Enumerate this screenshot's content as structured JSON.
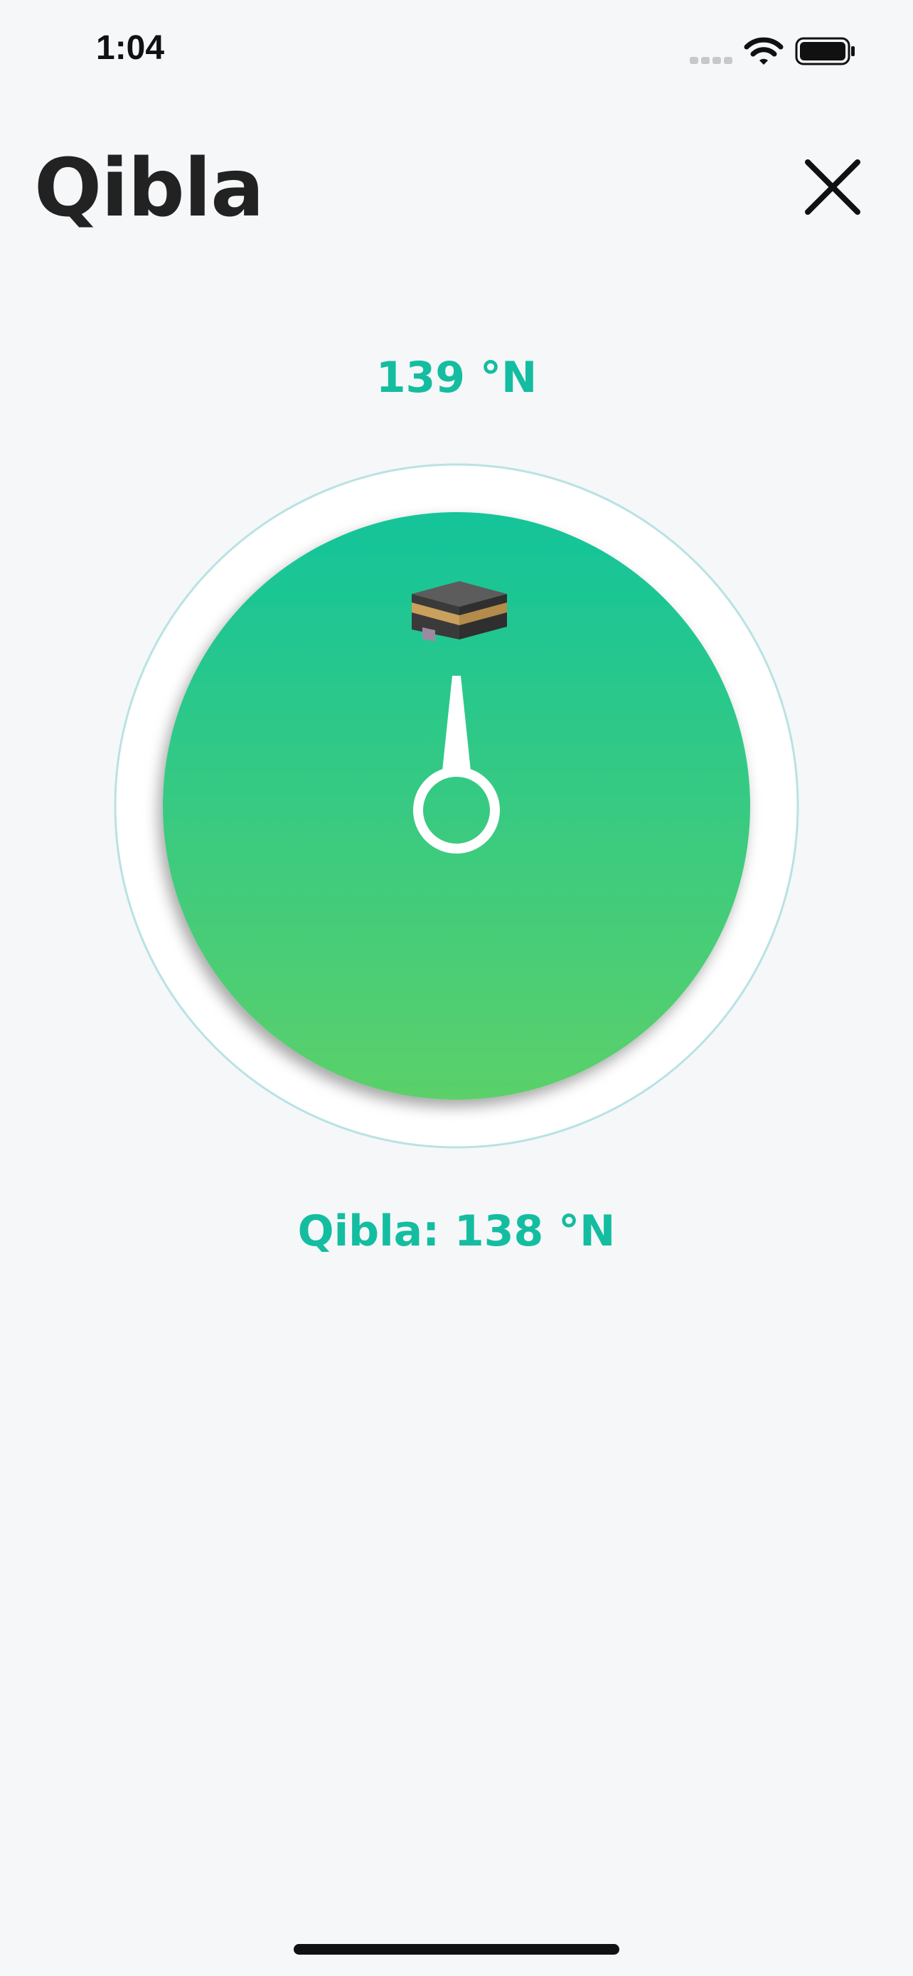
{
  "status_bar": {
    "time": "1:04",
    "icons": [
      "signal-icon",
      "wifi-icon",
      "battery-icon"
    ]
  },
  "header": {
    "title": "Qibla",
    "close_icon": "close-icon"
  },
  "compass": {
    "heading": "139 °N",
    "qibla": "Qibla: 138 °N",
    "kaaba_icon": "kaaba-icon",
    "colors": {
      "dial_top": "#14c49a",
      "dial_bottom": "#5bd06a",
      "ring": "#b9e2e3",
      "accent": "#14bda0"
    }
  }
}
